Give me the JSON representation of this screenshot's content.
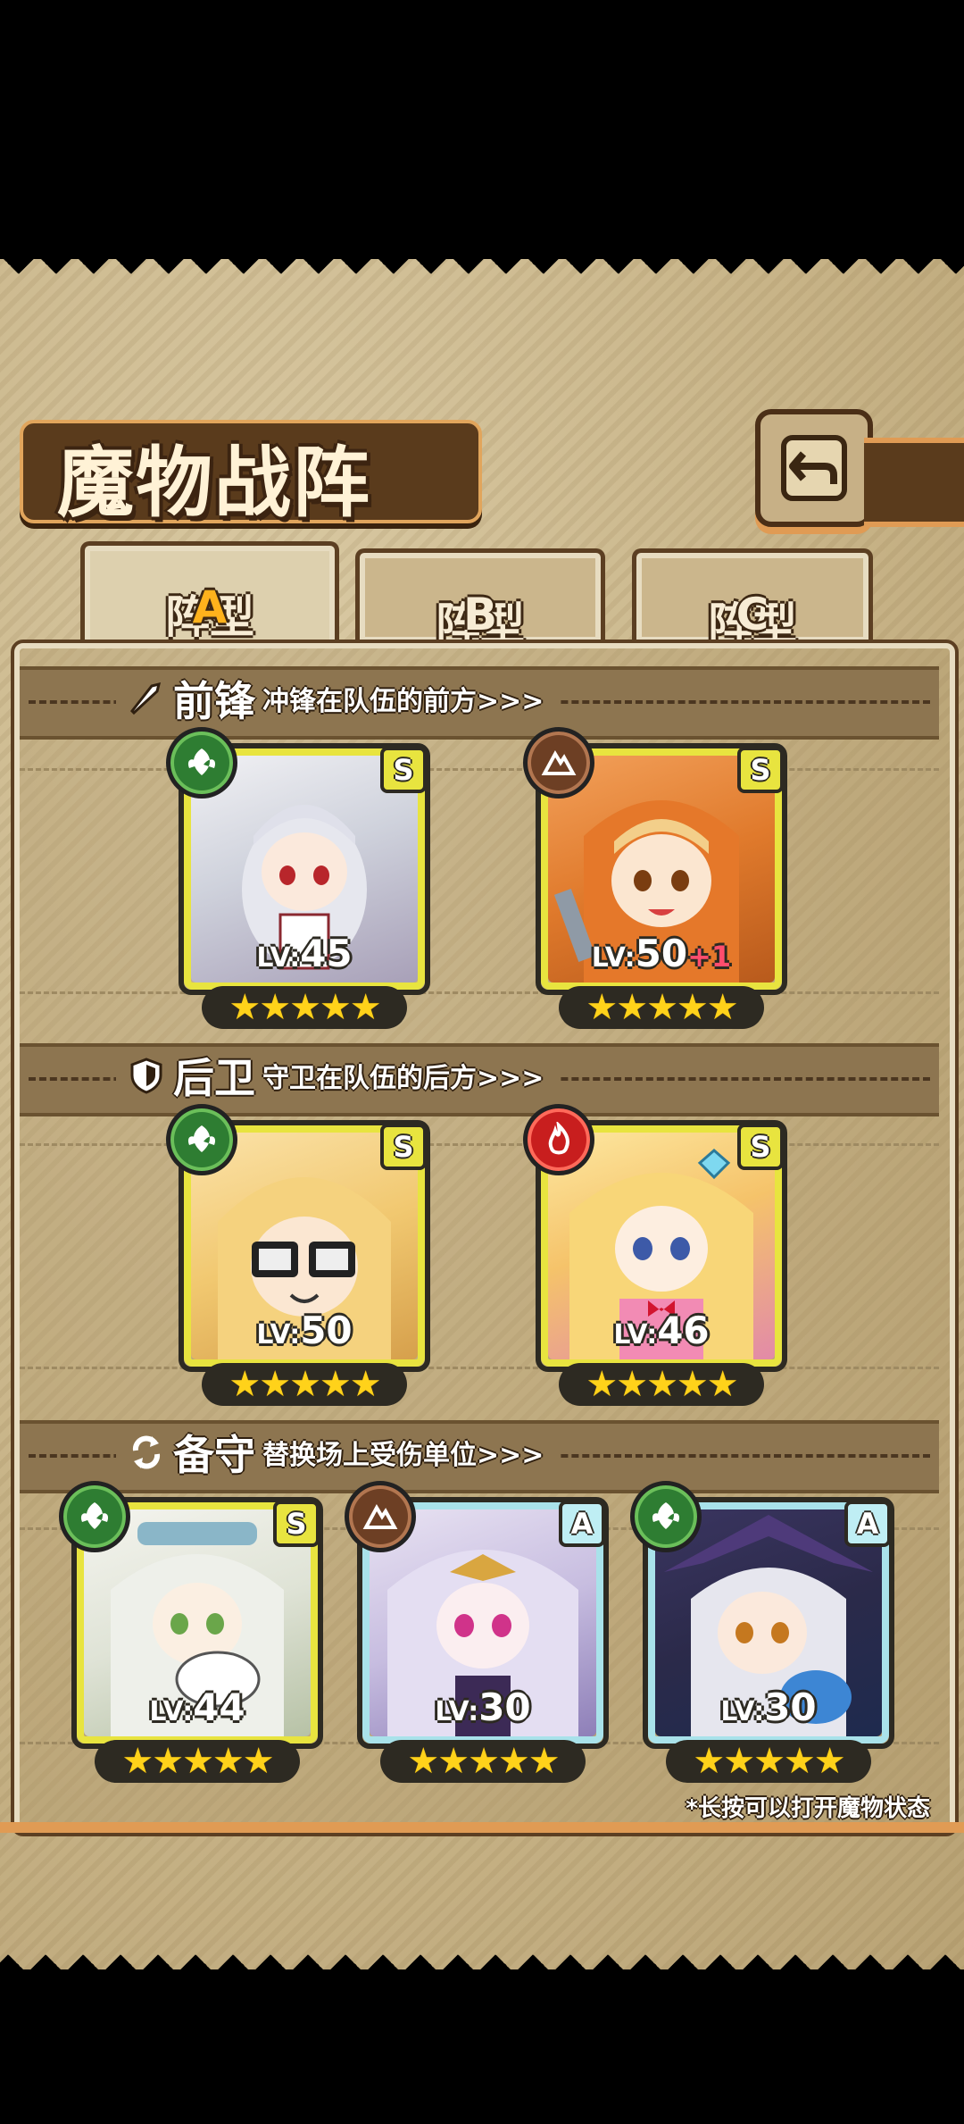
{
  "title": "魔物战阵",
  "tabs": [
    {
      "label": "阵型",
      "letter": "A",
      "active": true
    },
    {
      "label": "阵型",
      "letter": "B",
      "active": false
    },
    {
      "label": "阵型",
      "letter": "C",
      "active": false
    }
  ],
  "sections": {
    "front": {
      "title": "前锋",
      "desc": "冲锋在队伍的前方>>>"
    },
    "back": {
      "title": "后卫",
      "desc": "守卫在队伍的后方>>>"
    },
    "reserve": {
      "title": "备守",
      "desc": "替换场上受伤单位>>>"
    }
  },
  "cards": [
    {
      "lv_prefix": "LV:",
      "lv": "45",
      "plus": "",
      "rank": "S",
      "element": "grass",
      "stars": "★★★★★"
    },
    {
      "lv_prefix": "LV:",
      "lv": "50",
      "plus": "+1",
      "rank": "S",
      "element": "earth",
      "stars": "★★★★★"
    },
    {
      "lv_prefix": "LV:",
      "lv": "50",
      "plus": "",
      "rank": "S",
      "element": "grass",
      "stars": "★★★★★"
    },
    {
      "lv_prefix": "LV:",
      "lv": "46",
      "plus": "",
      "rank": "S",
      "element": "fire",
      "stars": "★★★★★"
    },
    {
      "lv_prefix": "LV:",
      "lv": "44",
      "plus": "",
      "rank": "S",
      "element": "grass",
      "stars": "★★★★★"
    },
    {
      "lv_prefix": "LV:",
      "lv": "30",
      "plus": "",
      "rank": "A",
      "element": "earth",
      "stars": "★★★★★"
    },
    {
      "lv_prefix": "LV:",
      "lv": "30",
      "plus": "",
      "rank": "A",
      "element": "grass",
      "stars": "★★★★★"
    }
  ],
  "footnote": "*长按可以打开魔物状态",
  "colors": {
    "accent": "#ffb21c",
    "rank_s": "#e8e43f",
    "rank_a": "#a9e2ea"
  }
}
